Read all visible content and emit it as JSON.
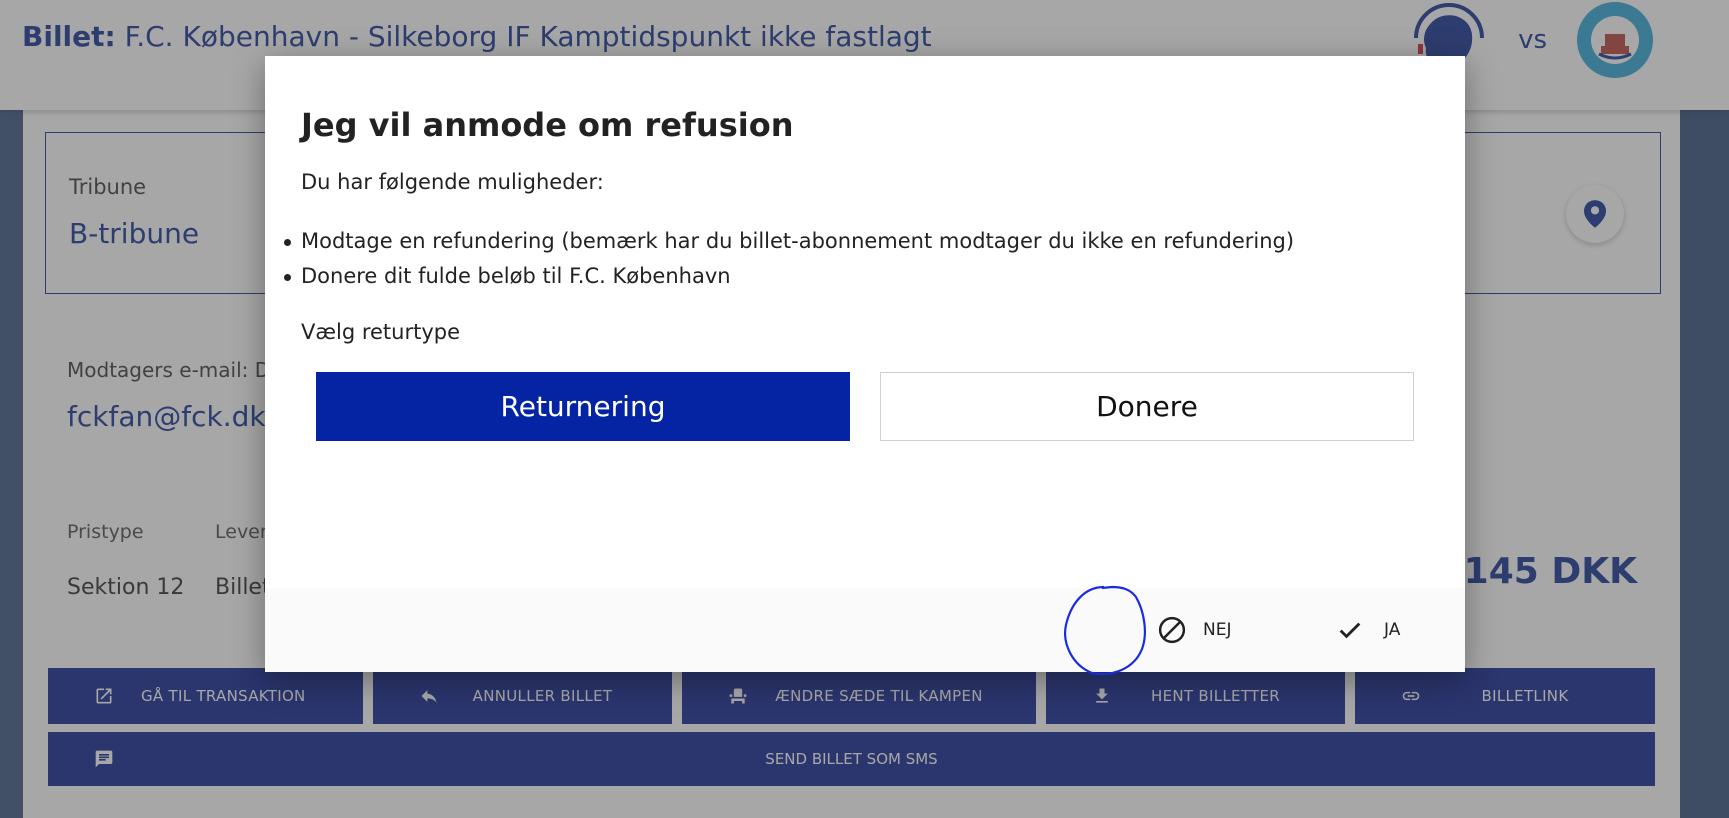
{
  "header": {
    "title_label": "Billet:",
    "title_text": "F.C. København - Silkeborg IF Kamptidspunkt ikke fastlagt",
    "vs": "vs"
  },
  "card": {
    "label": "Tribune",
    "value": "B-tribune"
  },
  "recipient": {
    "label": "Modtagers e-mail: D",
    "value": "fckfan@fck.dk"
  },
  "details": {
    "pristype_label": "Pristype",
    "pristype_value": "Sektion 12",
    "lever_label": "Lever",
    "lever_value": "Billet",
    "price": "145 DKK"
  },
  "actions": {
    "transaction": "GÅ TIL TRANSAKTION",
    "cancel": "ANNULLER BILLET",
    "change_seat": "ÆNDRE SÆDE TIL KAMPEN",
    "download": "HENT BILLETTER",
    "link": "BILLETLINK",
    "sms": "SEND BILLET SOM SMS"
  },
  "modal": {
    "title": "Jeg vil anmode om refusion",
    "subtitle": "Du har følgende muligheder:",
    "options": [
      "Modtage en refundering (bemærk har du billet-abonnement modtager du ikke en refundering)",
      "Donere dit fulde beløb til F.C. København"
    ],
    "type_label": "Vælg returtype",
    "return_button": "Returnering",
    "donate_button": "Donere",
    "no_button": "NEJ",
    "yes_button": "JA"
  },
  "icons": {
    "location": "location-pin-icon",
    "open_external": "open-in-new-icon",
    "reply": "reply-icon",
    "seat": "seat-icon",
    "download": "download-icon",
    "link": "link-icon",
    "message": "message-icon",
    "block": "block-icon",
    "check": "check-icon"
  },
  "colors": {
    "brand_blue": "#061a8c",
    "accent_blue": "#0424a4",
    "annotation": "#1a2be0"
  }
}
